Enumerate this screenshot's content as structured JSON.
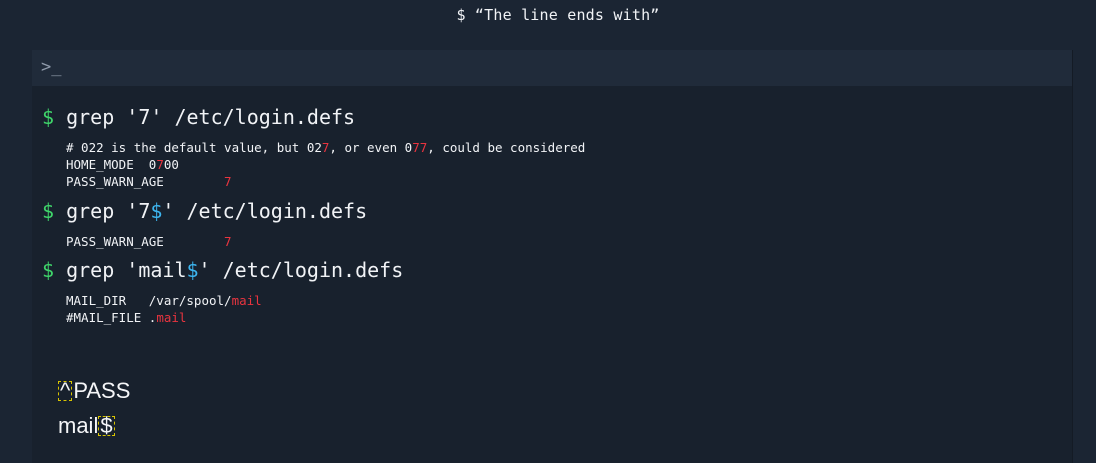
{
  "slide_title": "$ “The line ends with”",
  "terminal": {
    "prompt_icon": ">_",
    "commands": [
      {
        "dollar": "$",
        "pre": " grep '7",
        "anchor": "",
        "post": "' /etc/login.defs",
        "output": [
          {
            "a": "# 022 is the default value, but 02",
            "h": "7",
            "b": ", or even 0",
            "h2": "77",
            "c": ", could be considered"
          },
          {
            "a": "HOME_MODE  0",
            "h": "7",
            "b": "00"
          },
          {
            "a": "PASS_WARN_AGE        ",
            "h": "7",
            "b": ""
          }
        ]
      },
      {
        "dollar": "$",
        "pre": " grep '7",
        "anchor": "$",
        "post": "' /etc/login.defs",
        "output": [
          {
            "a": "PASS_WARN_AGE        ",
            "h": "7",
            "b": ""
          }
        ]
      },
      {
        "dollar": "$",
        "pre": " grep 'mail",
        "anchor": "$",
        "post": "' /etc/login.defs",
        "output": [
          {
            "a": "MAIL_DIR   /var/spool/",
            "h": "mail",
            "b": ""
          },
          {
            "a": "#MAIL_FILE .",
            "h": "mail",
            "b": ""
          }
        ]
      }
    ],
    "patterns": [
      {
        "box_first": true,
        "boxed": "^",
        "text": "PASS"
      },
      {
        "box_first": false,
        "boxed": "$",
        "text": "mail"
      }
    ]
  },
  "colors": {
    "dollar": "#3fd46a",
    "anchor": "#3db6f0",
    "match": "#e8343f",
    "box": "#d8c400"
  }
}
